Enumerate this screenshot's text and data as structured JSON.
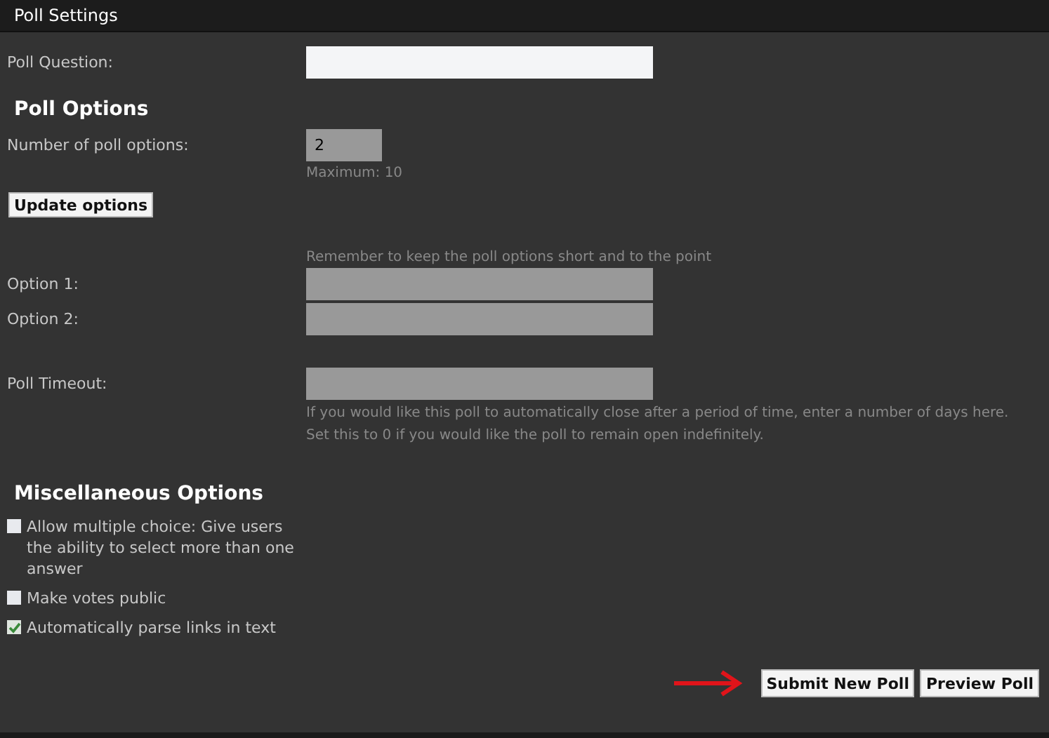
{
  "window": {
    "title": "Poll Settings"
  },
  "question": {
    "label": "Poll Question:"
  },
  "poll_options": {
    "heading": "Poll Options",
    "count_label": "Number of poll options:",
    "count_value": "2",
    "count_hint": "Maximum: 10",
    "update_button": "Update options",
    "hint": "Remember to keep the poll options short and to the point",
    "options": [
      {
        "label": "Option 1:"
      },
      {
        "label": "Option 2:"
      }
    ]
  },
  "timeout": {
    "label": "Poll Timeout:",
    "help": [
      "If you would like this poll to automatically close after a period of time, enter a number of days here.",
      "Set this to 0 if you would like the poll to remain open indefinitely."
    ]
  },
  "misc": {
    "heading": "Miscellaneous Options",
    "items": [
      {
        "label": "Allow multiple choice: Give users the ability to select more than one answer",
        "checked": false
      },
      {
        "label": "Make votes public",
        "checked": false
      },
      {
        "label": "Automatically parse links in text",
        "checked": true
      }
    ]
  },
  "buttons": [
    "Submit New Poll",
    "Preview Poll"
  ]
}
